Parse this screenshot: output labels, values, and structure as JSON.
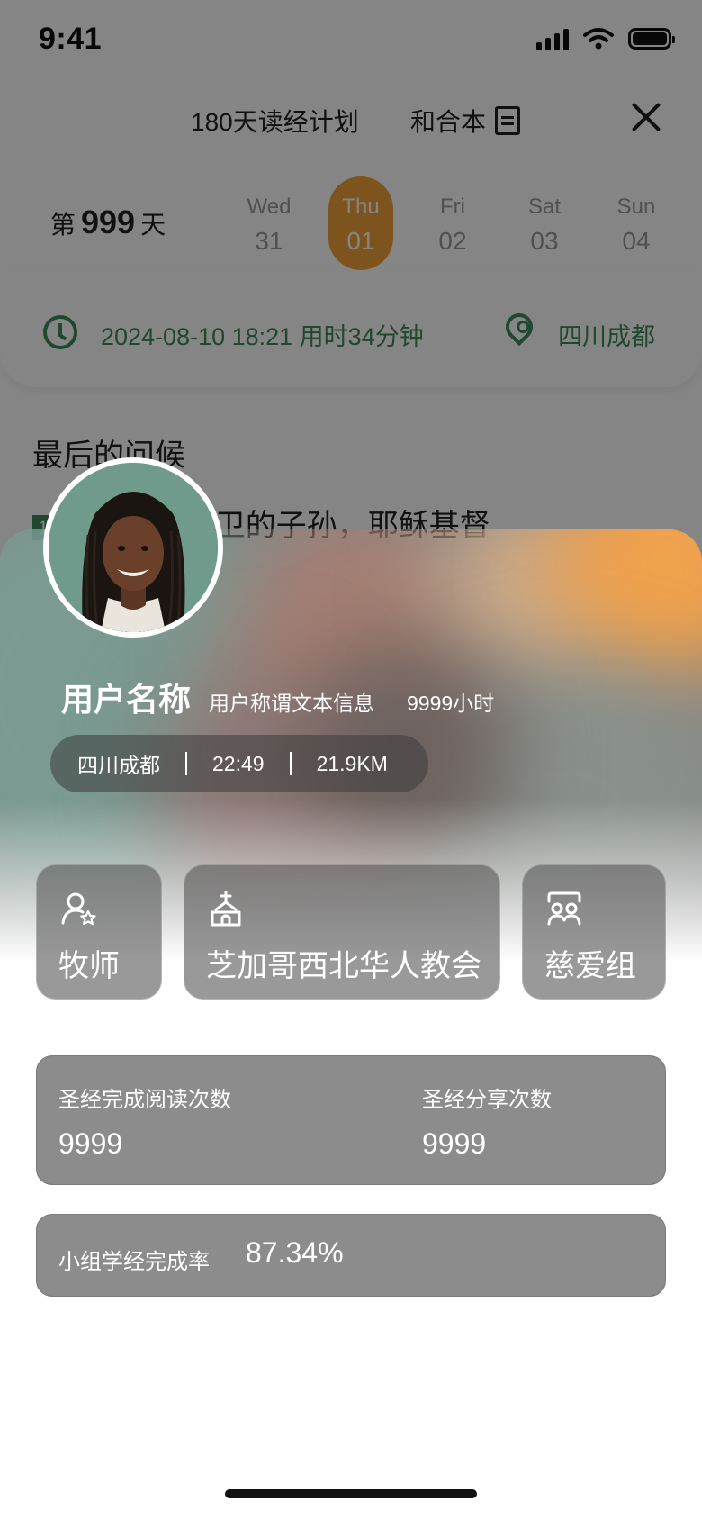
{
  "status_bar": {
    "time": "9:41"
  },
  "top_nav": {
    "plan_title": "180天读经计划",
    "version_label": "和合本"
  },
  "day_row": {
    "prefix": "第",
    "count": "999",
    "suffix": "天",
    "days": [
      {
        "weekday": "Wed",
        "date": "31"
      },
      {
        "weekday": "Thu",
        "date": "01"
      },
      {
        "weekday": "Fri",
        "date": "02"
      },
      {
        "weekday": "Sat",
        "date": "03"
      },
      {
        "weekday": "Sun",
        "date": "04"
      }
    ]
  },
  "info_row": {
    "datetime": "2024-08-10 18:21  用时34分钟",
    "location": "四川成都"
  },
  "passage": {
    "title": "最后的问候",
    "verse_number": "1",
    "text": "的后裔、大卫的子孙，耶稣基督"
  },
  "profile": {
    "name": "用户名称",
    "title": "用户称谓文本信息",
    "hours": "9999小时",
    "meta": {
      "location": "四川成都",
      "time": "22:49",
      "distance": "21.9KM"
    }
  },
  "roles": {
    "pastor": "牧师",
    "church": "芝加哥西北华人教会",
    "group": "慈爱组"
  },
  "stats": {
    "reads_label": "圣经完成阅读次数",
    "reads_value": "9999",
    "shares_label": "圣经分享次数",
    "shares_value": "9999",
    "rate_label": "小组学经完成率",
    "rate_value": "87.34%"
  },
  "colors": {
    "accent_orange": "#f0a23a",
    "accent_green": "#3d8a5a",
    "stat_card_bg": "#8c8c8c"
  }
}
